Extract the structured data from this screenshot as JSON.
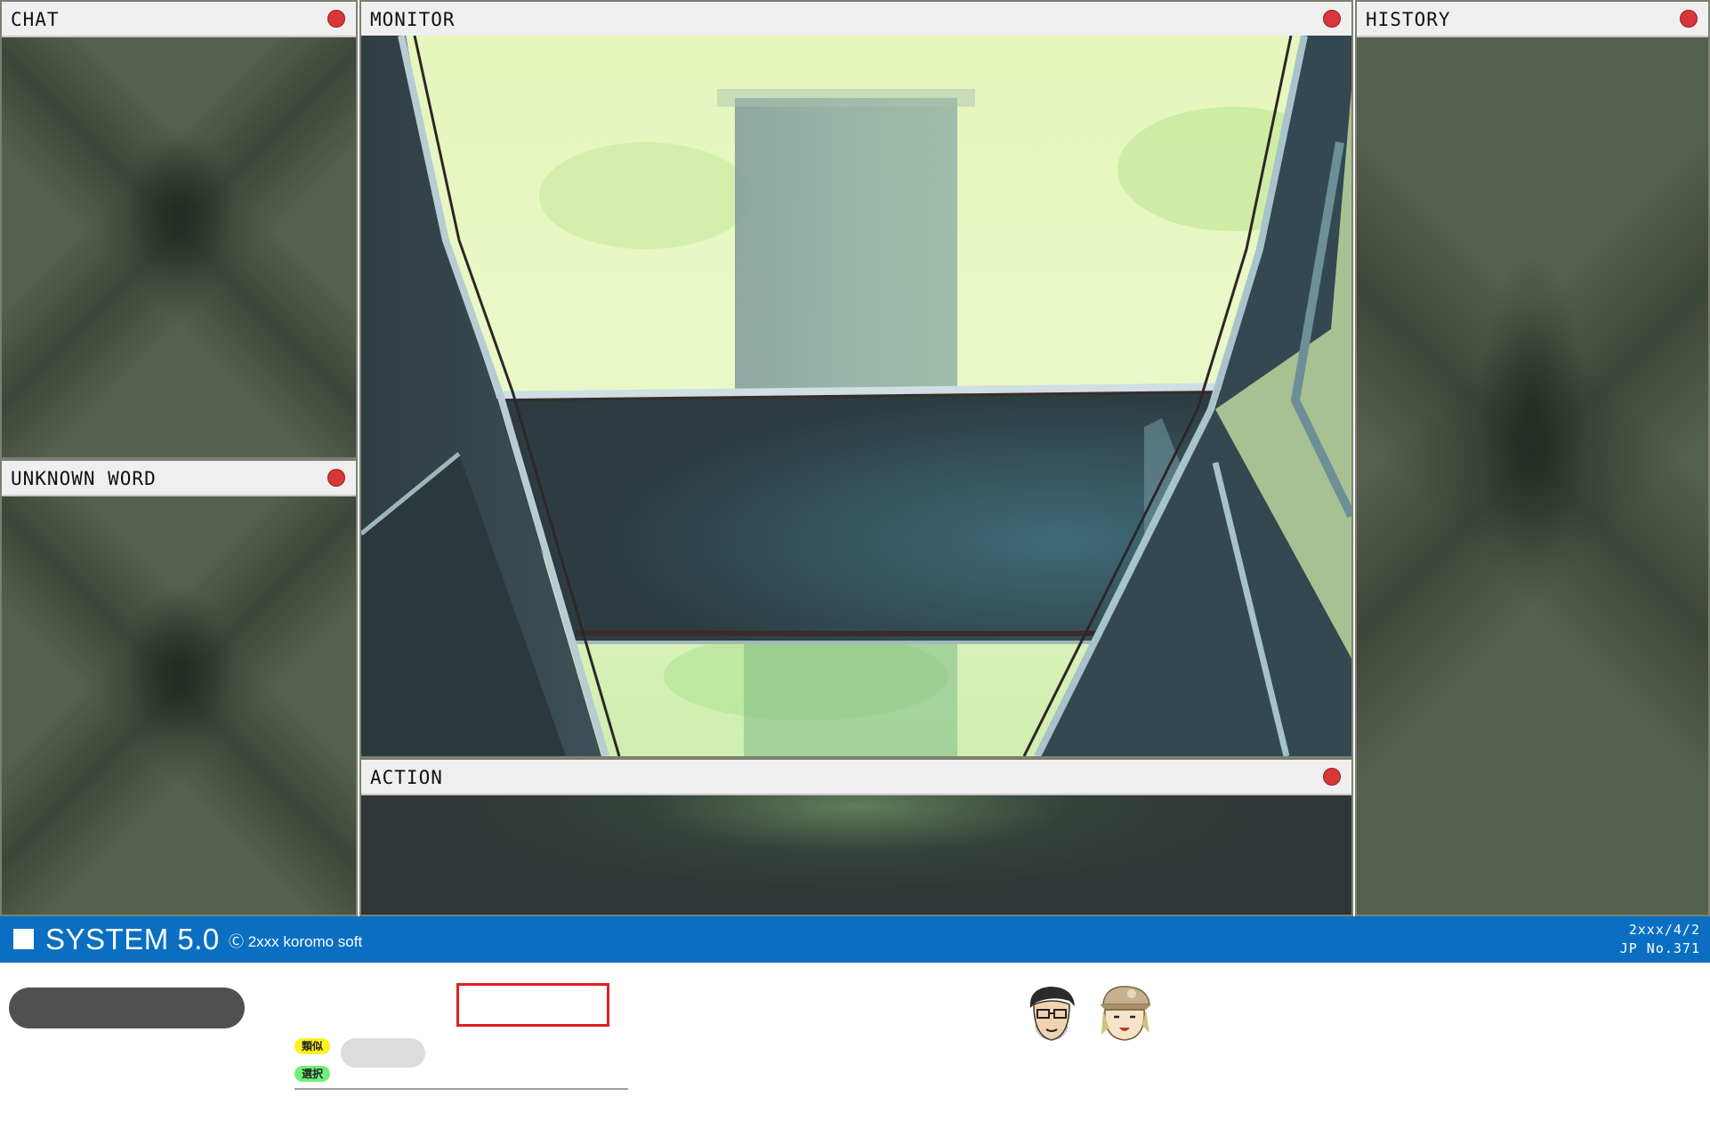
{
  "panels": {
    "chat": {
      "title": "CHAT"
    },
    "unknown_word": {
      "title": "UNKNOWN WORD"
    },
    "monitor": {
      "title": "MONITOR"
    },
    "history": {
      "title": "HISTORY"
    },
    "action": {
      "title": "ACTION"
    }
  },
  "status_bar": {
    "system_name": "SYSTEM 5.0",
    "copyright": "Ⓒ 2xxx koromo soft",
    "date": "2xxx/4/2",
    "number": "JP No.371",
    "color": "#0a6fc2"
  },
  "bottom": {
    "tag_similar": "類似",
    "tag_select": "選択"
  },
  "characters": [
    {
      "name": "man-with-glasses-avatar"
    },
    {
      "name": "girl-with-cap-avatar"
    }
  ]
}
